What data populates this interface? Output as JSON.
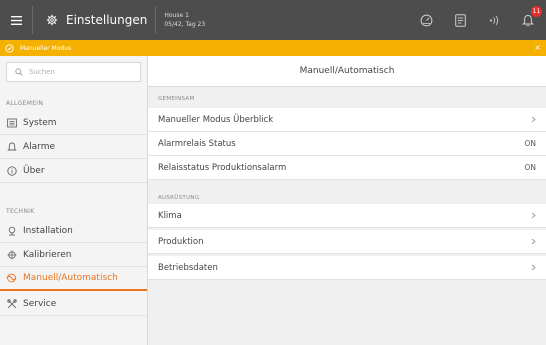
{
  "topbar": {
    "menu_icon": "hamburger-icon",
    "settings_icon": "gear-icon",
    "title": "Einstellungen",
    "house_name": "House 1",
    "house_sub": "05/42, Tag 23",
    "icons": [
      "gauge-icon",
      "document-icon",
      "signal-icon",
      "bell-icon"
    ],
    "alarm_count": "11"
  },
  "mode_banner": {
    "icon": "manual-mode-icon",
    "label": "Manueller Modus",
    "close": "×",
    "color": "#f4b100"
  },
  "sidebar": {
    "search_placeholder": "Suchen",
    "sections": [
      {
        "heading": "ALLGEMEIN",
        "items": [
          {
            "label": "System",
            "icon": "system-icon"
          },
          {
            "label": "Alarme",
            "icon": "alarm-bell-icon"
          },
          {
            "label": "Über",
            "icon": "info-icon"
          }
        ]
      },
      {
        "heading": "TECHNIK",
        "items": [
          {
            "label": "Installation",
            "icon": "installation-icon"
          },
          {
            "label": "Kalibrieren",
            "icon": "calibrate-icon"
          },
          {
            "label": "Manuell/Automatisch",
            "icon": "manual-auto-icon",
            "active": true
          },
          {
            "label": "Service",
            "icon": "tools-icon"
          }
        ]
      }
    ],
    "accent_color": "#e8741e"
  },
  "main": {
    "title": "Manuell/Automatisch",
    "sections": [
      {
        "heading": "GEMEINSAM",
        "rows": [
          {
            "label": "Manueller Modus Überblick",
            "value": null
          },
          {
            "label": "Alarmrelais Status",
            "value": "ON"
          },
          {
            "label": "Relaisstatus Produktionsalarm",
            "value": "ON"
          }
        ]
      },
      {
        "heading": "AUSRÜSTUNG",
        "rows": [
          {
            "label": "Klima",
            "value": null
          },
          {
            "label": "Produktion",
            "value": null
          },
          {
            "label": "Betriebsdaten",
            "value": null
          }
        ]
      }
    ]
  }
}
